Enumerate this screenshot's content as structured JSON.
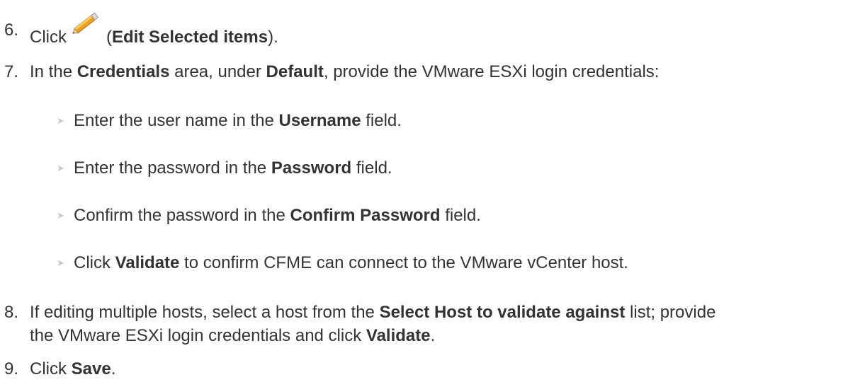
{
  "steps": [
    {
      "num": "6.",
      "parts": [
        "Click",
        "(",
        "Edit Selected items",
        ")."
      ],
      "icon": "pencil-icon"
    },
    {
      "num": "7.",
      "parts": [
        "In the ",
        "Credentials",
        " area, under ",
        "Default",
        ", provide the VMware ESXi login credentials:"
      ]
    },
    {
      "num": "8.",
      "line1": [
        "If editing multiple hosts, select a host from the ",
        "Select Host to validate against",
        " list; provide"
      ],
      "line2": [
        "the VMware ESXi login credentials and click ",
        "Validate",
        "."
      ]
    },
    {
      "num": "9.",
      "parts": [
        "Click ",
        "Save",
        "."
      ]
    }
  ],
  "subs": [
    {
      "parts": [
        "Enter the user name in the ",
        "Username",
        " field."
      ]
    },
    {
      "parts": [
        "Enter the password in the ",
        "Password",
        " field."
      ]
    },
    {
      "parts": [
        "Confirm the password in the ",
        "Confirm Password",
        " field."
      ]
    },
    {
      "parts": [
        "Click ",
        "Validate",
        " to confirm CFME can connect to the VMware vCenter host."
      ]
    }
  ],
  "bullet_glyph": "➤"
}
